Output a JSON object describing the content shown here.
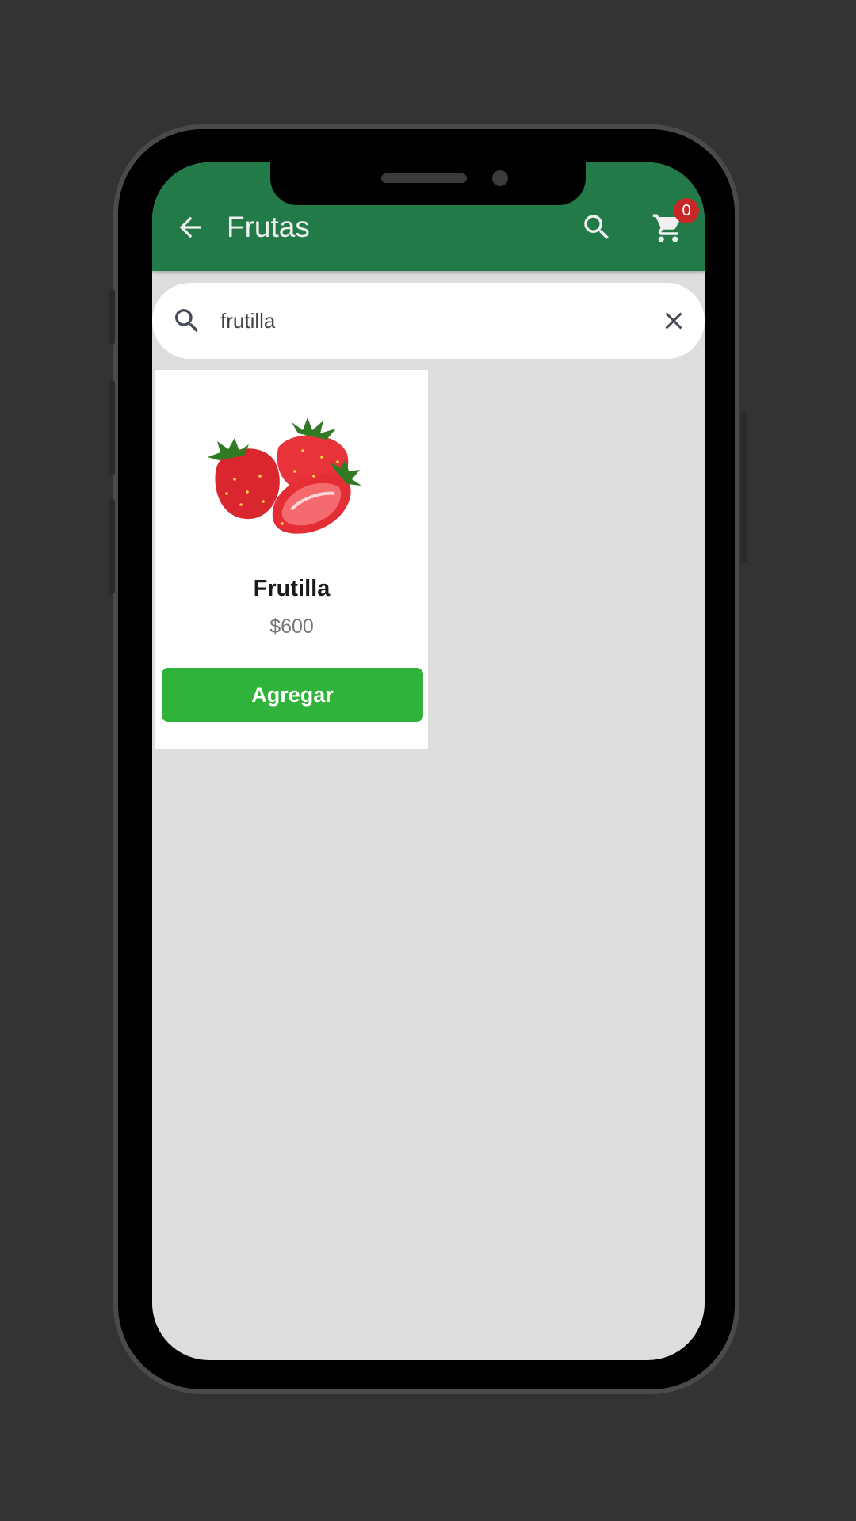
{
  "app": {
    "title": "Frutas",
    "cart_count": "0"
  },
  "icons": {
    "back": "arrow-left-icon",
    "search": "search-icon",
    "cart": "shopping-cart-icon",
    "clear": "close-icon"
  },
  "search": {
    "value": "frutilla"
  },
  "products": [
    {
      "name": "Frutilla",
      "price": "$600",
      "button_label": "Agregar"
    }
  ],
  "colors": {
    "appbar": "#227a49",
    "add_button": "#2fb33a",
    "badge": "#c62828",
    "background": "#dddddd"
  }
}
